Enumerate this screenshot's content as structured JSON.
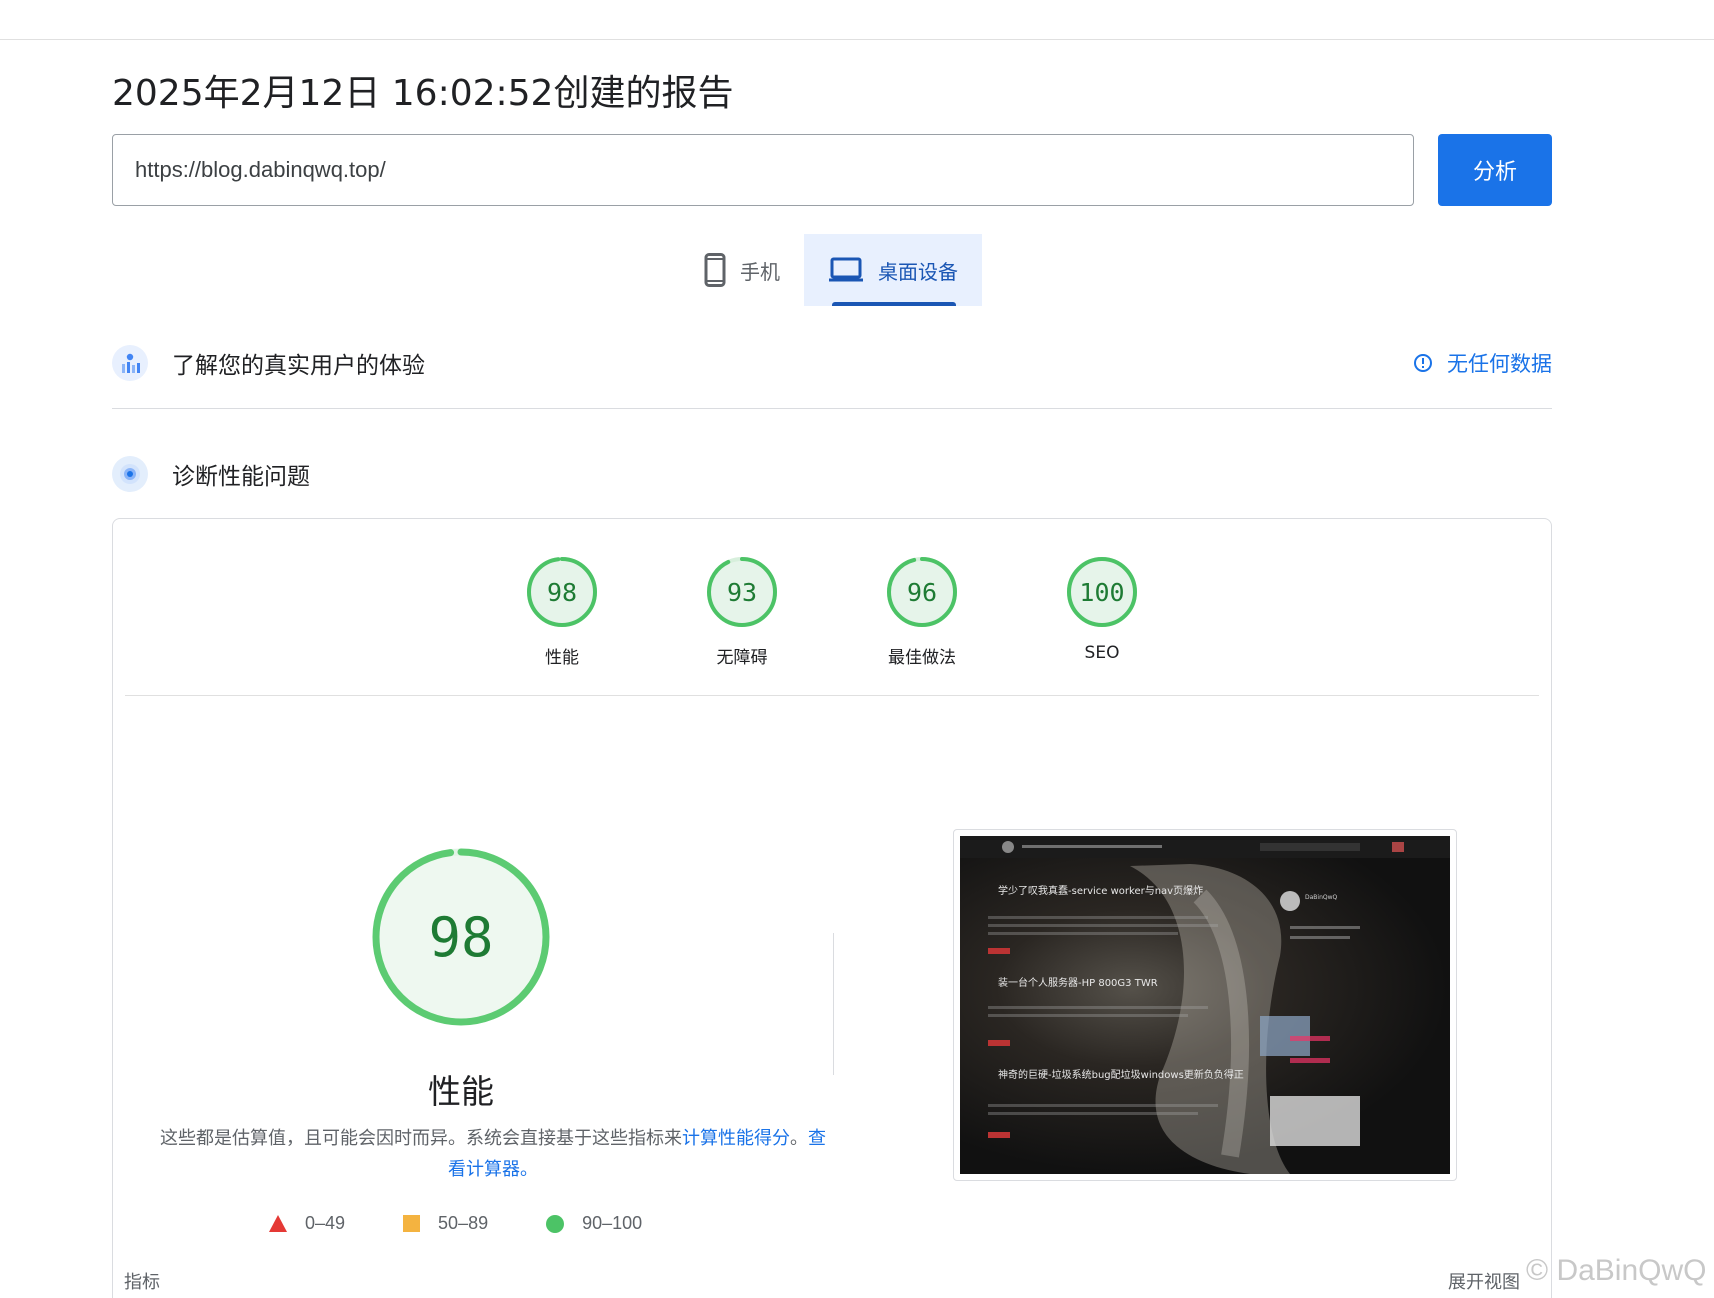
{
  "report": {
    "title": "2025年2月12日 16:02:52创建的报告"
  },
  "url_field": {
    "value": "https://blog.dabinqwq.top/"
  },
  "analyze_button": {
    "label": "分析"
  },
  "device_tabs": [
    {
      "label": "手机",
      "icon": "smartphone-icon",
      "active": false
    },
    {
      "label": "桌面设备",
      "icon": "laptop-icon",
      "active": true
    }
  ],
  "field_data": {
    "title": "了解您的真实用户的体验",
    "status": "无任何数据",
    "icon": "users-chart-icon"
  },
  "diagnose": {
    "title": "诊断性能问题",
    "icon": "lighthouse-icon"
  },
  "scores": [
    {
      "label": "性能",
      "value": "98",
      "score": 98
    },
    {
      "label": "无障碍",
      "value": "93",
      "score": 93
    },
    {
      "label": "最佳做法",
      "value": "96",
      "score": 96
    },
    {
      "label": "SEO",
      "value": "100",
      "score": 100
    }
  ],
  "performance": {
    "score": "98",
    "title": "性能",
    "desc_text": "这些都是估算值，且可能会因时而异。系统会直接基于这些指标来",
    "desc_link1": "计算性能得分",
    "desc_sep": "。",
    "desc_link2": "查看计算器。"
  },
  "legend": [
    {
      "shape": "triangle",
      "label": "0–49",
      "color": "#e53935"
    },
    {
      "shape": "square",
      "label": "50–89",
      "color": "#f4b340"
    },
    {
      "shape": "circle",
      "label": "90–100",
      "color": "#4cc366"
    }
  ],
  "screenshot": {
    "post1_title": "学少了叹我真蠢-service worker与nav页爆炸",
    "post2_title": "装一台个人服务器-HP 800G3 TWR",
    "post3_title": "神奇的巨硬-垃圾系统bug配垃圾windows更新负负得正",
    "author": "DaBinQwQ"
  },
  "footer": {
    "metrics_label": "指标",
    "expand_label": "展开视图",
    "watermark": "© DaBinQwQ"
  },
  "colors": {
    "pass": "#4cc366",
    "pass_text": "#1e7b34",
    "accent": "#1a73e8"
  }
}
